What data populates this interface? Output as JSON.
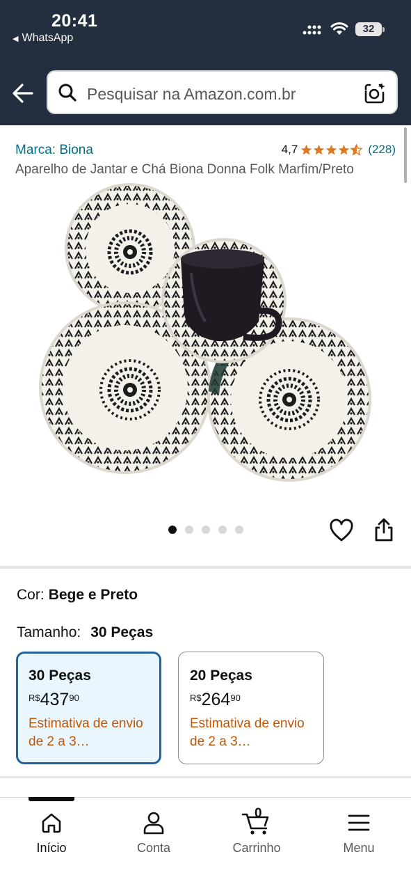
{
  "status_bar": {
    "time": "20:41",
    "back_app": "WhatsApp",
    "battery": "32"
  },
  "search": {
    "placeholder": "Pesquisar na Amazon.com.br"
  },
  "product": {
    "brand": "Marca: Biona",
    "rating_value": "4,7",
    "rating_stars": 4.7,
    "rating_count": "(228)",
    "title": "Aparelho de Jantar e Chá Biona Donna Folk Marfim/Preto",
    "image_count": 5,
    "active_image": 1
  },
  "options": {
    "color_label": "Cor:",
    "color_value": "Bege e Preto",
    "size_label": "Tamanho:",
    "size_value": "30 Peças",
    "sizes": [
      {
        "name": "30 Peças",
        "currency": "R$",
        "whole": "437",
        "cents": "90",
        "shipping": "Estimativa de envio de 2 a 3…",
        "selected": true
      },
      {
        "name": "20 Peças",
        "currency": "R$",
        "whole": "264",
        "cents": "90",
        "shipping": "Estimativa de envio de 2 a 3…",
        "selected": false
      }
    ]
  },
  "bottom_nav": [
    {
      "label": "Início",
      "icon": "home-icon",
      "active": true
    },
    {
      "label": "Conta",
      "icon": "user-icon",
      "active": false
    },
    {
      "label": "Carrinho",
      "icon": "cart-icon",
      "active": false,
      "badge": "0"
    },
    {
      "label": "Menu",
      "icon": "menu-icon",
      "active": false
    }
  ],
  "colors": {
    "header_bg": "#232f3e",
    "link": "#007185",
    "star": "#de7921",
    "shipping": "#c45500",
    "selected_border": "#2162a1",
    "selected_bg": "#eaf6fe"
  }
}
